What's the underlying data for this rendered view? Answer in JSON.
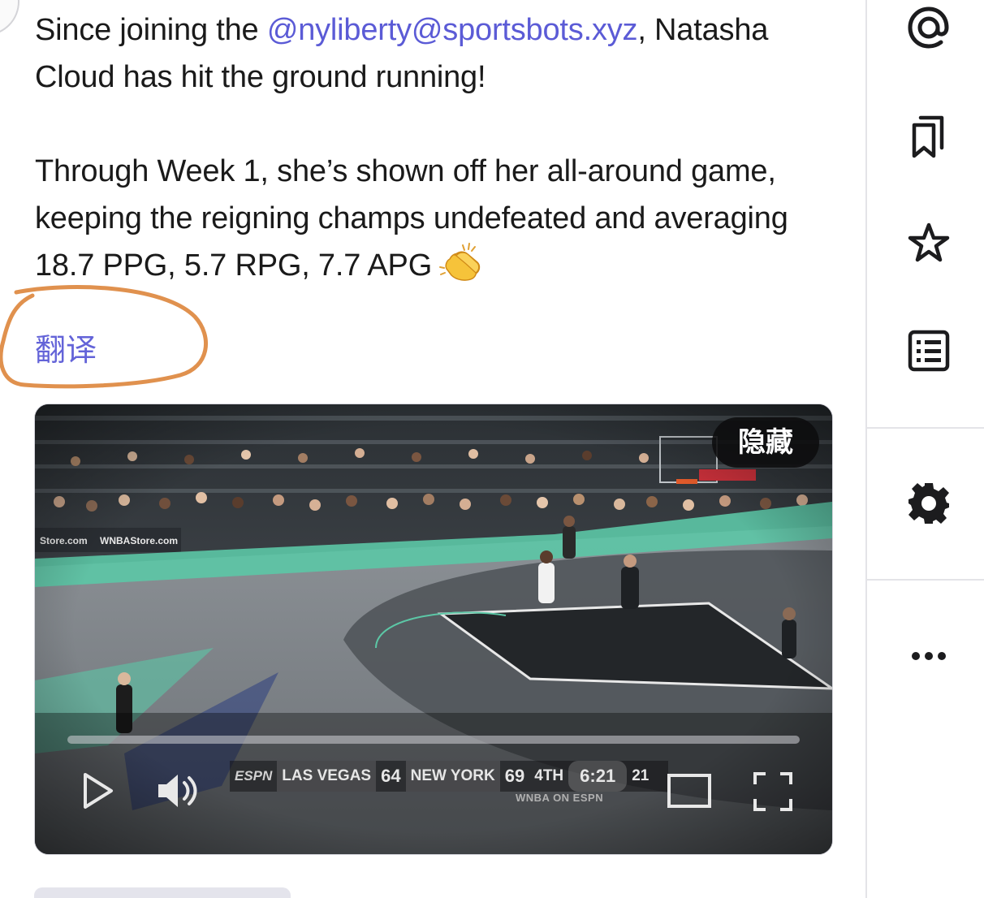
{
  "post": {
    "text_before_mention": "Since joining the ",
    "mention": "@nyliberty@sportsbots.xyz",
    "text_after_mention": ", Natasha Cloud has hit the ground running!",
    "paragraph2": "Through Week 1, she’s shown off her all-around game, keeping the reigning champs undefeated and averaging 18.7 PPG, 5.7 RPG, 7.7 APG",
    "translate_label": "翻译"
  },
  "video": {
    "hide_label": "隐藏",
    "progress": 0,
    "scorebug": {
      "network": "ESPN",
      "away_team": "LAS VEGAS",
      "away_score": "64",
      "home_team": "NEW YORK",
      "home_score": "69",
      "quarter": "4TH",
      "clock": "6:21",
      "shot_clock": "21",
      "sub_line": "WNBA ON ESPN"
    }
  },
  "sidebar": {
    "icons": [
      "mention-icon",
      "bookmarks-icon",
      "star-icon",
      "list-icon",
      "settings-gear-icon",
      "more-options-icon"
    ]
  },
  "colors": {
    "link": "#5b5bd6",
    "translate": "#6363d8",
    "annotation": "#e0914e",
    "court_teal": "#6fd6b5"
  }
}
